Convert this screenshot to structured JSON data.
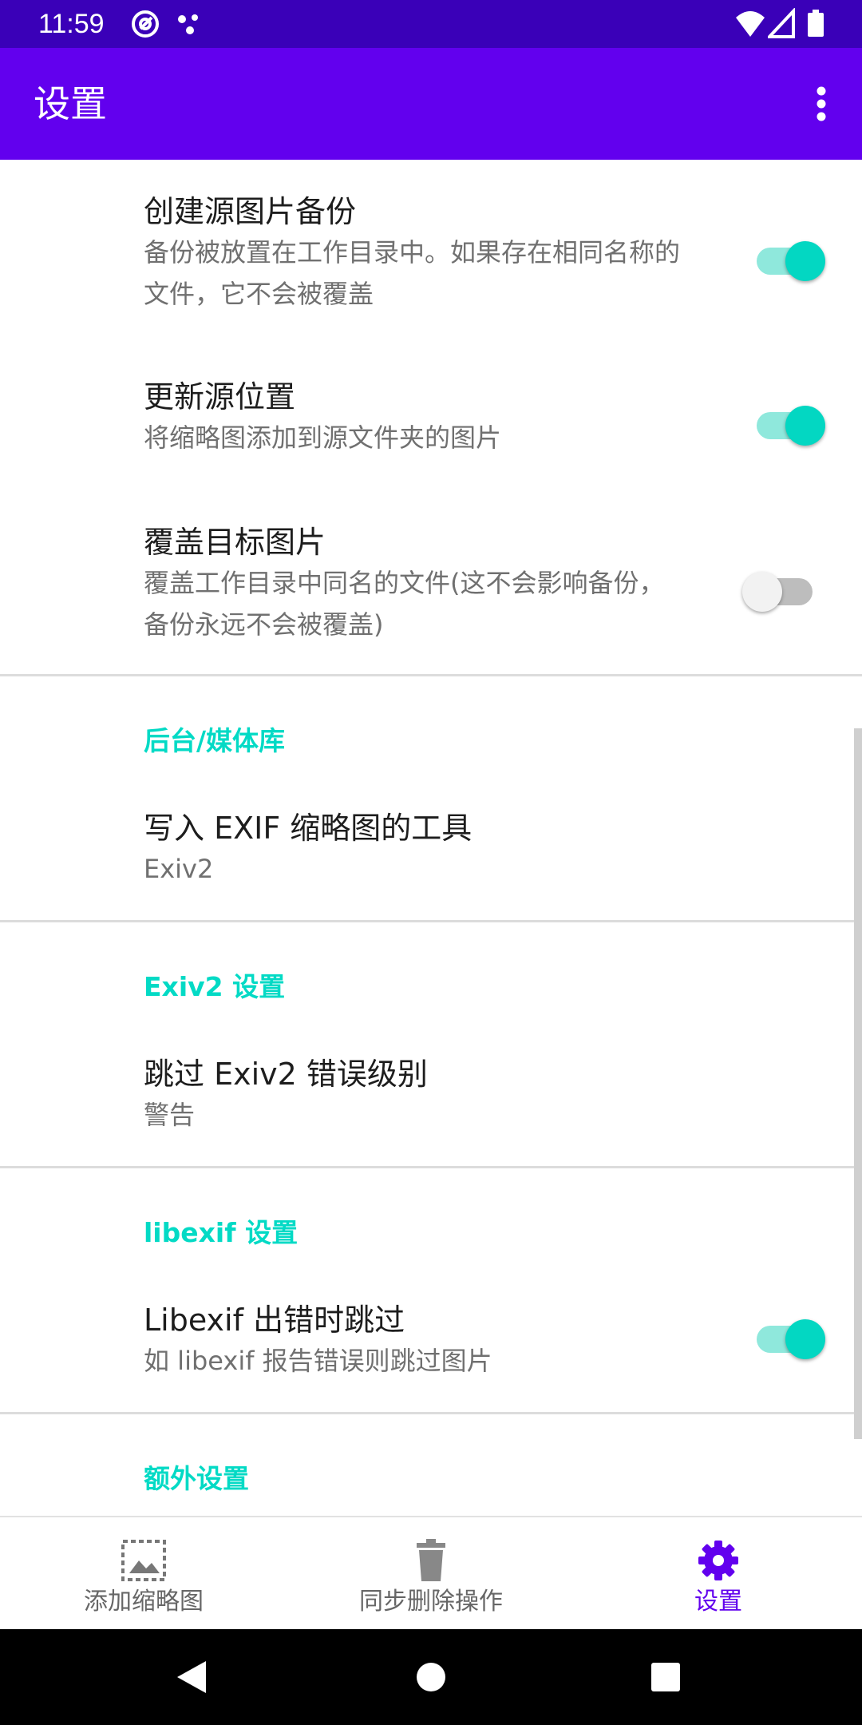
{
  "status_bar": {
    "time": "11:59",
    "icons": [
      "at-sign-icon",
      "dots-icon",
      "wifi-icon",
      "signal-icon",
      "battery-icon"
    ]
  },
  "app_bar": {
    "title": "设置",
    "overflow_icon": "more-vert-icon"
  },
  "preferences": {
    "create_backup": {
      "title": "创建源图片备份",
      "summary": "备份被放置在工作目录中。如果存在相同名称的文件，它不会被覆盖",
      "enabled": true
    },
    "update_source": {
      "title": "更新源位置",
      "summary": "将缩略图添加到源文件夹的图片",
      "enabled": true
    },
    "overwrite_target": {
      "title": "覆盖目标图片",
      "summary": "覆盖工作目录中同名的文件(这不会影响备份，备份永远不会被覆盖)",
      "enabled": false
    },
    "backend_category": "后台/媒体库",
    "exif_tool": {
      "title": "写入 EXIF 缩略图的工具",
      "summary": "Exiv2"
    },
    "exiv2_category": "Exiv2 设置",
    "exiv2_skip": {
      "title": "跳过 Exiv2 错误级别",
      "summary": "警告"
    },
    "libexif_category": "libexif 设置",
    "libexif_skip": {
      "title": "Libexif 出错时跳过",
      "summary": "如 libexif 报告错误则跳过图片",
      "enabled": true
    },
    "extra_category": "额外设置"
  },
  "bottom_nav": {
    "items": [
      {
        "label": "添加缩略图",
        "icon": "add-thumbnail-icon",
        "active": false
      },
      {
        "label": "同步删除操作",
        "icon": "trash-icon",
        "active": false
      },
      {
        "label": "设置",
        "icon": "gear-icon",
        "active": true
      }
    ]
  },
  "system_nav": {
    "icons": [
      "back-icon",
      "home-icon",
      "recents-icon"
    ]
  },
  "colors": {
    "primary": "#6200ee",
    "status_bar": "#3a00b8",
    "accent": "#03dac5"
  }
}
